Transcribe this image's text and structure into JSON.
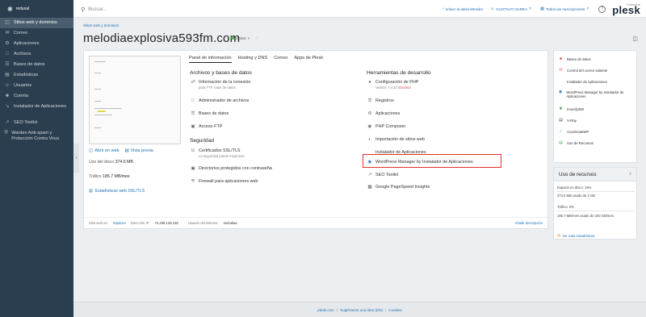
{
  "topbar": {
    "logo_text": "reduxal",
    "search_placeholder": "Buscar...",
    "back_admin": "Volver al administrador",
    "user": "GUSTAVO NAREA",
    "subscriptions": "Todos las suscripciones",
    "help": "?",
    "powered_by": "Powered by",
    "plesk": "plesk"
  },
  "sidebar": {
    "items": [
      {
        "label": "Sitios web y dominios",
        "icon": "globe-icon"
      },
      {
        "label": "Correo",
        "icon": "mail-icon"
      },
      {
        "label": "Aplicaciones",
        "icon": "gear-icon"
      },
      {
        "label": "Archivos",
        "icon": "folder-icon"
      },
      {
        "label": "Bases de datos",
        "icon": "database-icon"
      },
      {
        "label": "Estadísticas",
        "icon": "stats-icon"
      },
      {
        "label": "Usuarios",
        "icon": "user-icon"
      },
      {
        "label": "Cuenta",
        "icon": "account-icon"
      },
      {
        "label": "Instalador de Aplicaciones",
        "icon": "installer-icon"
      },
      {
        "label": "SEO Toolkit",
        "icon": "seo-icon"
      },
      {
        "label": "Warden Anti-spam y Protección Contra Virus",
        "icon": "shield-icon"
      }
    ]
  },
  "main": {
    "breadcrumb": "Sitios web y dominios",
    "domain": "melodiaexplosiva593fm.com",
    "status": "Activo",
    "tabs": [
      "Panel de información",
      "Hosting y DNS",
      "Correo",
      "Apps de Plesk"
    ],
    "open_web": "Abrir en web",
    "preview": "Vista previa",
    "disk_label": "Uso del disco",
    "disk_value": "374.6 MB",
    "traffic_label": "Tráfico",
    "traffic_value": "185.7 MB/mes",
    "ssl_stats": "Estadísticas web SSL/TLS",
    "col1_title": "Archivos y bases de datos",
    "col1_items": [
      {
        "label": "Información de la conexión",
        "sub": "para FTP, base de datos"
      },
      {
        "label": "Administrador de archivos"
      },
      {
        "label": "Bases de datos"
      },
      {
        "label": "Acceso FTP"
      }
    ],
    "security_title": "Seguridad",
    "security_items": [
      {
        "label": "Certificados SSL/TLS",
        "sub": "La seguridad puede mejorarse"
      },
      {
        "label": "Directorios protegidos con contraseña"
      },
      {
        "label": "Firewall para aplicaciones web"
      }
    ],
    "col2_title": "Herramientas de desarrollo",
    "php": {
      "label": "Configuración de PHP",
      "sub_prefix": "Versión 7.4.33 ",
      "sub_warn": "obsoleta"
    },
    "col2_items": [
      "Registros",
      "Aplicaciones",
      "PHP Composer",
      "Importación de sitios web",
      "Instalador de Aplicaciones",
      "WordPress Manager by Instalador de Aplicaciones",
      "SEO Toolkit",
      "Google PageSpeed Insights"
    ],
    "footer": {
      "web_on": "Sitio web en",
      "web_on_value": "httpdocs",
      "ip_label": "Dirección IP",
      "ip_value": "74.208.139.136",
      "user_label": "Usuario del sistema",
      "user_value": "melodiaa",
      "add_desc": "Añadir descripción"
    }
  },
  "right_panel": {
    "items": [
      {
        "label": "Bases de datos",
        "color": "#e05353"
      },
      {
        "label": "Control del correo saliente",
        "color": "#e05353"
      },
      {
        "label": "Instalador de Aplicaciones",
        "color": "#777777"
      },
      {
        "label": "WordPress Manager by Instalador de Aplicaciones",
        "color": "#2b6cb0"
      },
      {
        "label": "Imunify360",
        "color": "#2e7d32"
      },
      {
        "label": "X-Ray",
        "color": "#2b3e4f"
      },
      {
        "label": "AccelerateWP",
        "color": "#3aa0d8"
      },
      {
        "label": "Uso de Recursos",
        "color": "#3a9d5d"
      }
    ],
    "resources": {
      "title": "Uso de recursos",
      "disk_label": "Espacio en disco: 18%",
      "disk_value": "374.6 MB usado de 2 GB",
      "traffic_label": "Tráfico: 0%",
      "traffic_value": "185.7 MB/mes usado de 200 GB/mes",
      "more": "Ver más estadísticas"
    }
  },
  "page_footer": {
    "links": [
      "plesk.com",
      "Sugiéranos una idea (EN)",
      "Cookies"
    ]
  }
}
